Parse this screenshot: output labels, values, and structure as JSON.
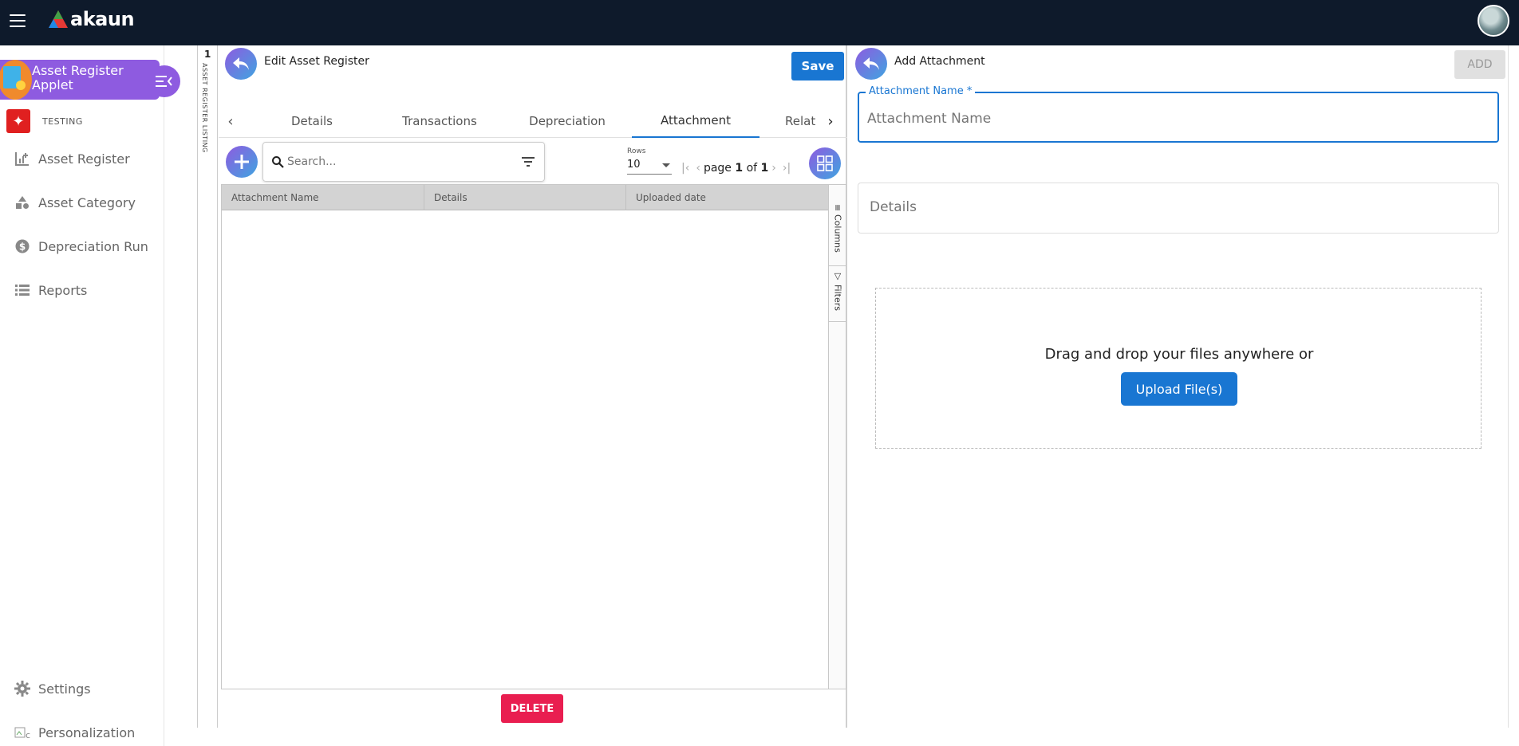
{
  "brand": {
    "name": "akaun"
  },
  "sidebar": {
    "applet_title": "Asset Register Applet",
    "org_name": "TESTING",
    "items": [
      {
        "label": "Asset Register",
        "icon": "chart-add-icon"
      },
      {
        "label": "Asset Category",
        "icon": "shapes-icon"
      },
      {
        "label": "Depreciation Run",
        "icon": "dollar-circle-icon"
      },
      {
        "label": "Reports",
        "icon": "list-icon"
      }
    ],
    "settings_label": "Settings",
    "personalization_label": "Personalization"
  },
  "strip": {
    "count": "1",
    "label": "ASSET REGISTER LISTING"
  },
  "edit_panel": {
    "title": "Edit Asset Register",
    "save_label": "Save",
    "tabs": [
      {
        "label": "Details"
      },
      {
        "label": "Transactions"
      },
      {
        "label": "Depreciation"
      },
      {
        "label": "Attachment",
        "active": true
      },
      {
        "label": "Relat"
      }
    ],
    "search_placeholder": "Search...",
    "rows_label": "Rows",
    "rows_value": "10",
    "page_word": "page",
    "page_current": "1",
    "page_of": "of",
    "page_total": "1",
    "columns": [
      "Attachment Name",
      "Details",
      "Uploaded date"
    ],
    "side_tabs": {
      "columns": "Columns",
      "filters": "Filters"
    },
    "delete_label": "DELETE"
  },
  "attachment_panel": {
    "title": "Add Attachment",
    "add_label": "ADD",
    "name_label": "Attachment Name *",
    "name_placeholder": "Attachment Name",
    "details_placeholder": "Details",
    "drop_text": "Drag and drop your files anywhere or",
    "upload_label": "Upload File(s)"
  },
  "colors": {
    "topbar": "#0e1a2b",
    "applet_purple": "#8e5be0",
    "primary_blue": "#1976d2",
    "delete_red": "#e91e50"
  }
}
